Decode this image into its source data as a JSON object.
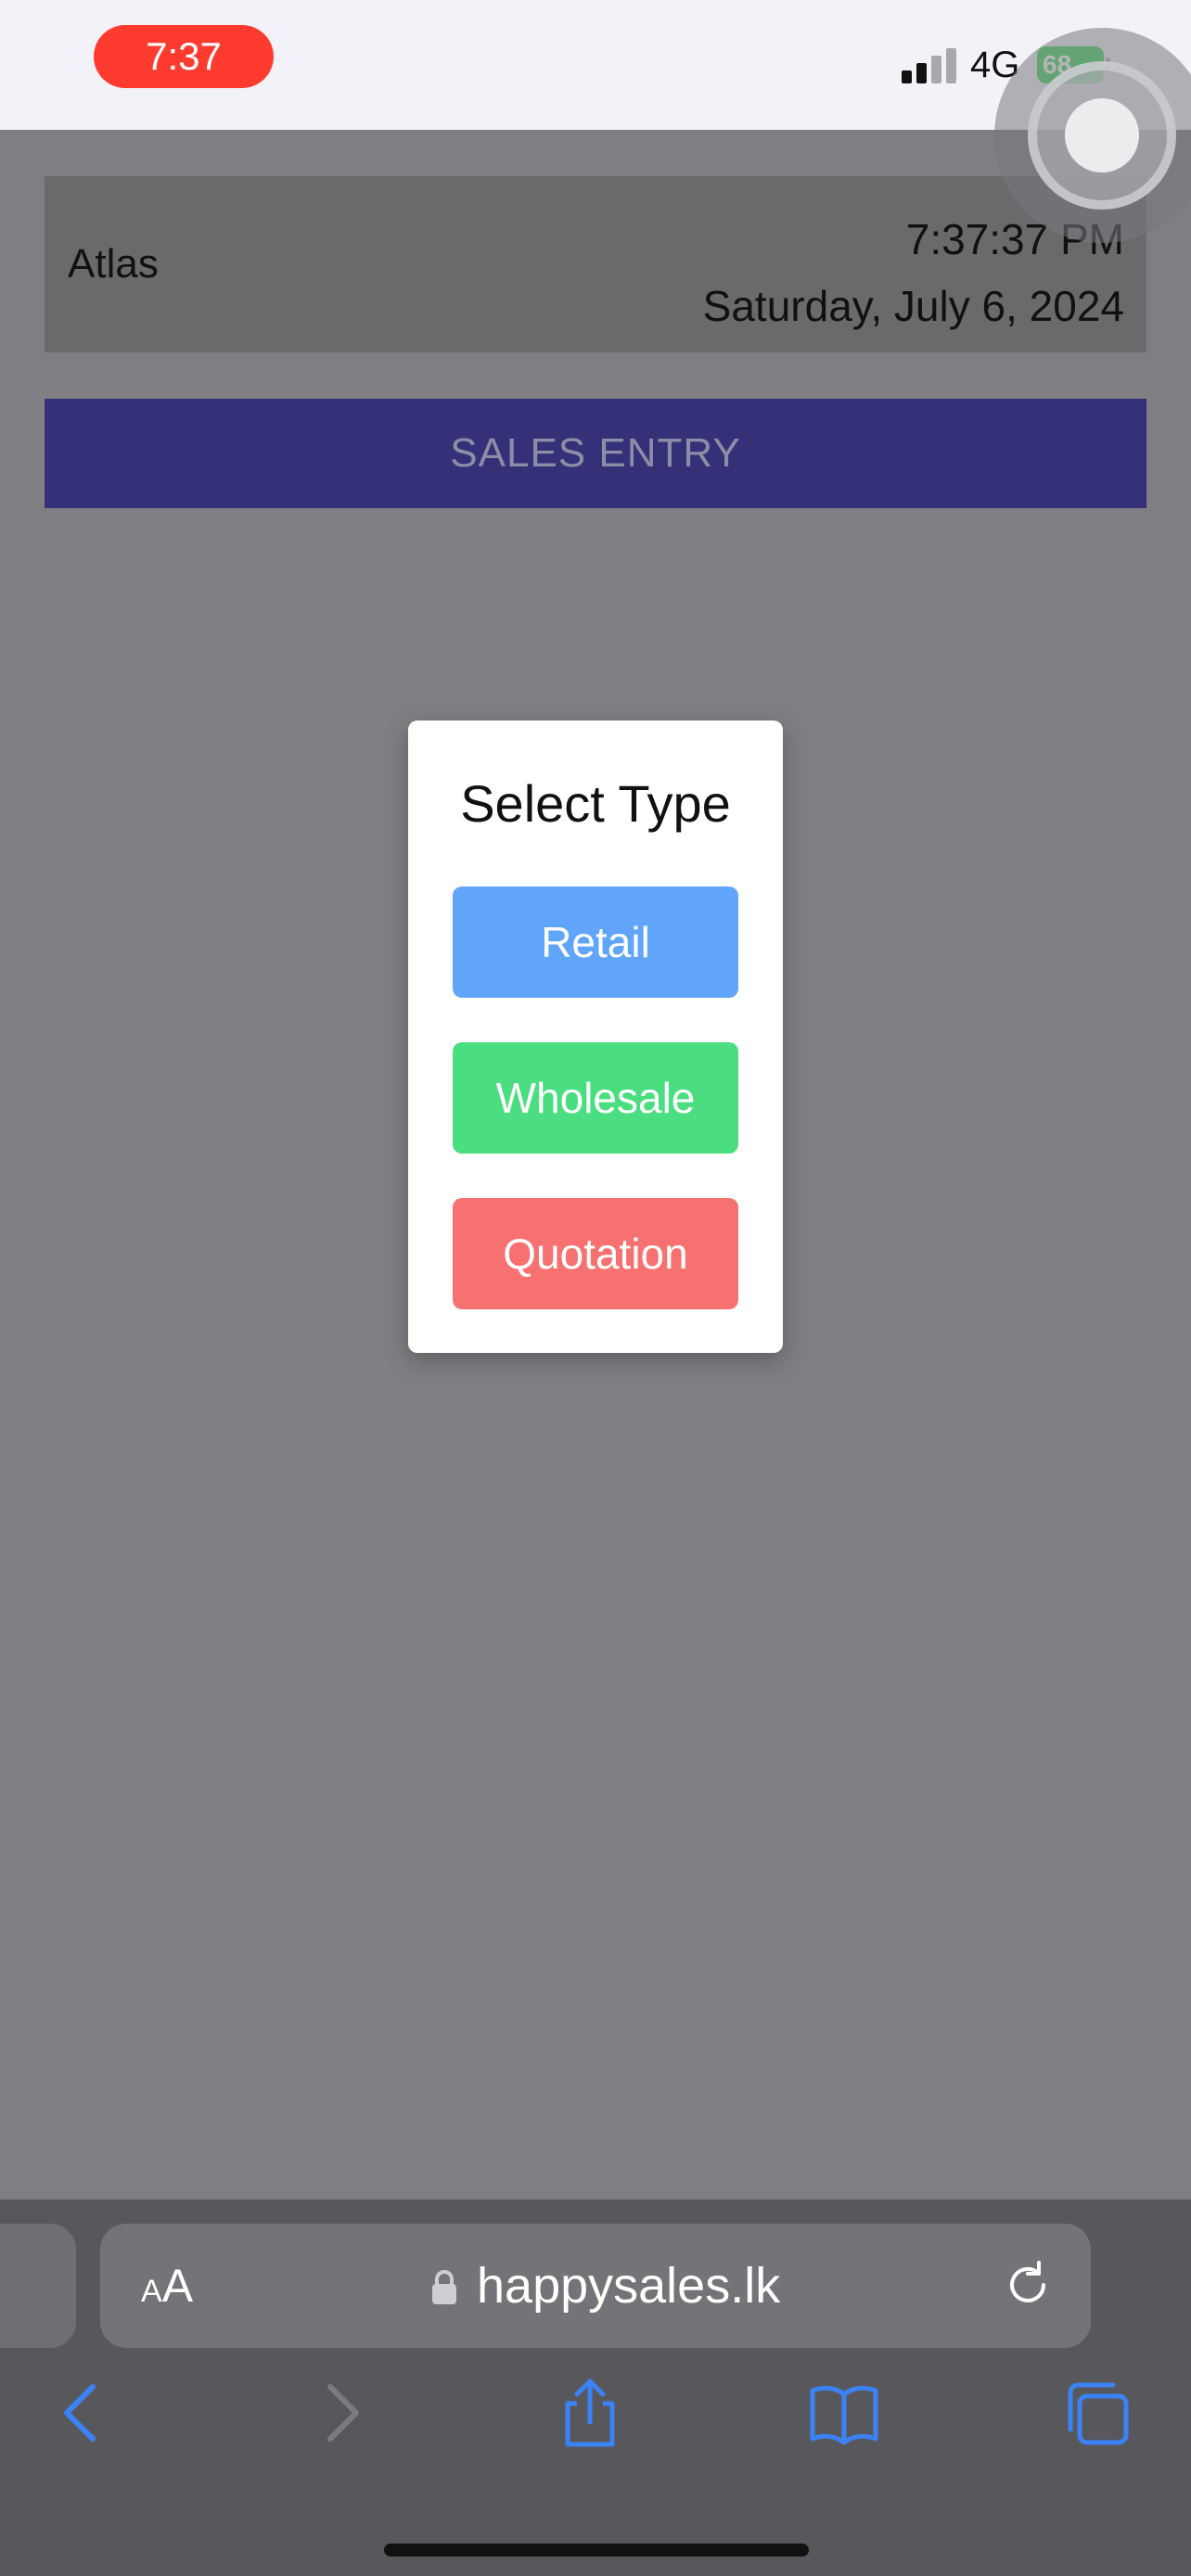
{
  "status_bar": {
    "time": "7:37",
    "network": "4G",
    "battery": "68"
  },
  "header": {
    "shop_name": "Atlas",
    "time": "7:37:37 PM",
    "date": "Saturday, July 6, 2024"
  },
  "banner": {
    "label": "SALES ENTRY"
  },
  "modal": {
    "title": "Select Type",
    "buttons": [
      {
        "label": "Retail",
        "color": "#60a5fa"
      },
      {
        "label": "Wholesale",
        "color": "#4ade80"
      },
      {
        "label": "Quotation",
        "color": "#f87171"
      }
    ]
  },
  "browser": {
    "reader_label_small": "A",
    "reader_label": "A",
    "url": "happysales.lk"
  },
  "colors": {
    "recording_pill": "#ff3b30",
    "banner_bg": "#353178",
    "toolbar_accent": "#3b82f6"
  }
}
